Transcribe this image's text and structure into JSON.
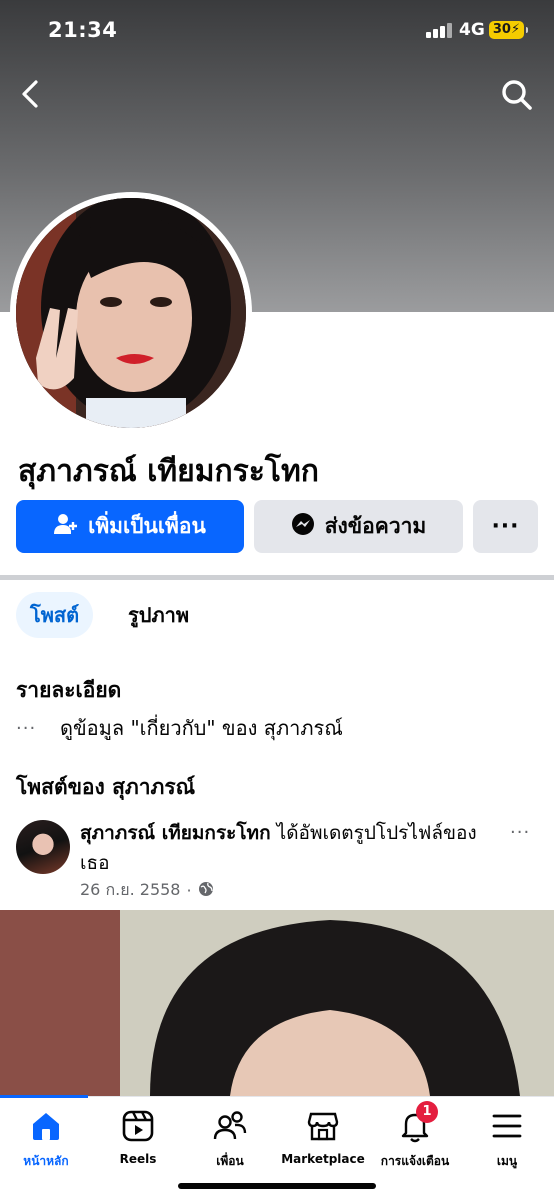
{
  "status_bar": {
    "time": "21:34",
    "network": "4G",
    "battery": "30"
  },
  "profile": {
    "name": "สุภาภรณ์ เทียมกระโทก"
  },
  "actions": {
    "add_friend": "เพิ่มเป็นเพื่อน",
    "message": "ส่งข้อความ",
    "more": "···"
  },
  "tabs": [
    {
      "label": "โพสต์"
    },
    {
      "label": "รูปภาพ"
    }
  ],
  "details": {
    "title": "รายละเอียด",
    "about_link": "ดูข้อมูล \"เกี่ยวกับ\" ของ สุภาภรณ์",
    "dots": "···"
  },
  "posts_section": {
    "title": "โพสต์ของ สุภาภรณ์"
  },
  "post": {
    "author": "สุภาภรณ์ เทียมกระโทก",
    "action": "ได้อัพเดตรูปโปรไฟล์ของเธอ",
    "date": "26 ก.ย. 2558",
    "dot": "·",
    "more": "···"
  },
  "tabbar": {
    "items": [
      {
        "label": "หน้าหลัก"
      },
      {
        "label": "Reels"
      },
      {
        "label": "เพื่อน"
      },
      {
        "label": "Marketplace"
      },
      {
        "label": "การแจ้งเตือน",
        "badge": "1"
      },
      {
        "label": "เมนู"
      }
    ]
  },
  "colors": {
    "accent": "#0866ff",
    "badge": "#e41e3f",
    "muted": "#65676b",
    "button_bg": "#e4e6eb"
  },
  "icons": [
    "back-chevron-icon",
    "search-icon",
    "add-person-icon",
    "messenger-icon",
    "globe-icon",
    "home-icon",
    "reels-icon",
    "friends-icon",
    "marketplace-icon",
    "bell-icon",
    "menu-icon"
  ]
}
